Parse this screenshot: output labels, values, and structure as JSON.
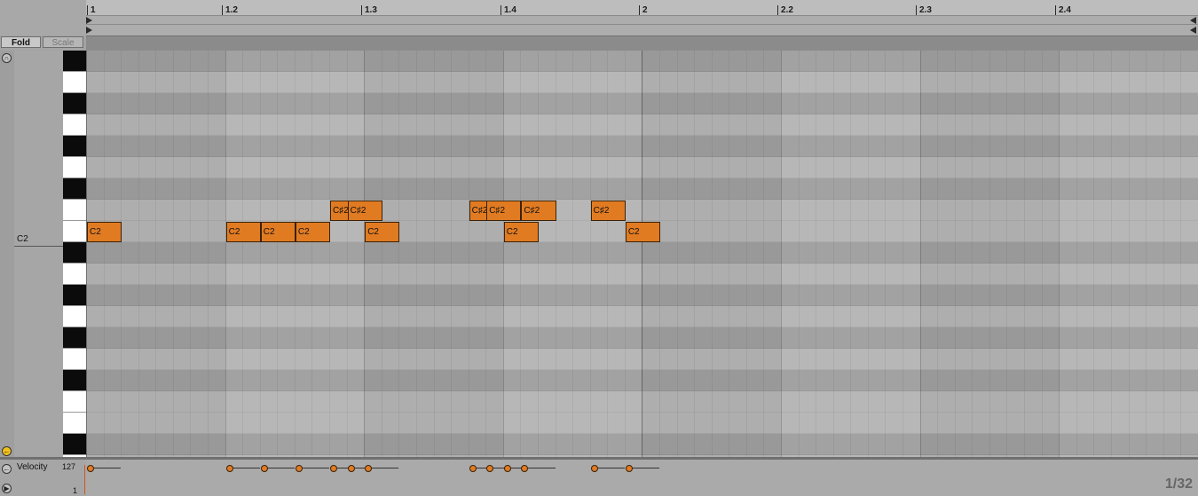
{
  "ruler": {
    "labels": [
      {
        "text": "1"
      },
      {
        "text": "1.2"
      },
      {
        "text": "1.3"
      },
      {
        "text": "1.4"
      },
      {
        "text": "2"
      },
      {
        "text": "2.2"
      },
      {
        "text": "2.3"
      },
      {
        "text": "2.4"
      }
    ]
  },
  "header": {
    "fold_label": "Fold",
    "scale_label": "Scale"
  },
  "keyboard": {
    "c2_label": "C2"
  },
  "notes": [
    {
      "pitch": "C2",
      "start": 0,
      "length": 0.25,
      "label": "C2"
    },
    {
      "pitch": "C2",
      "start": 2,
      "length": 0.25,
      "label": "C2"
    },
    {
      "pitch": "C2",
      "start": 2.5,
      "length": 0.25,
      "label": "C2"
    },
    {
      "pitch": "C2",
      "start": 3,
      "length": 0.25,
      "label": "C2"
    },
    {
      "pitch": "C#2",
      "start": 3.5,
      "length": 0.25,
      "label": "C♯2"
    },
    {
      "pitch": "C#2",
      "start": 3.75,
      "length": 0.25,
      "label": "C♯2"
    },
    {
      "pitch": "C2",
      "start": 4,
      "length": 0.25,
      "label": "C2"
    },
    {
      "pitch": "C#2",
      "start": 5.5,
      "length": 0.25,
      "label": "C♯2"
    },
    {
      "pitch": "C#2",
      "start": 5.75,
      "length": 0.25,
      "label": "C♯2"
    },
    {
      "pitch": "C2",
      "start": 6,
      "length": 0.25,
      "label": "C2"
    },
    {
      "pitch": "C#2",
      "start": 6.25,
      "length": 0.25,
      "label": "C♯2"
    },
    {
      "pitch": "C#2",
      "start": 7.25,
      "length": 0.25,
      "label": "C♯2"
    },
    {
      "pitch": "C2",
      "start": 7.75,
      "length": 0.25,
      "label": "C2"
    }
  ],
  "velocity": {
    "label": "Velocity",
    "max_label": "127",
    "min_label": "1"
  },
  "grid": {
    "quantization": "1/32"
  },
  "colors": {
    "note": "#e17b22",
    "background": "#a4a4a4"
  }
}
